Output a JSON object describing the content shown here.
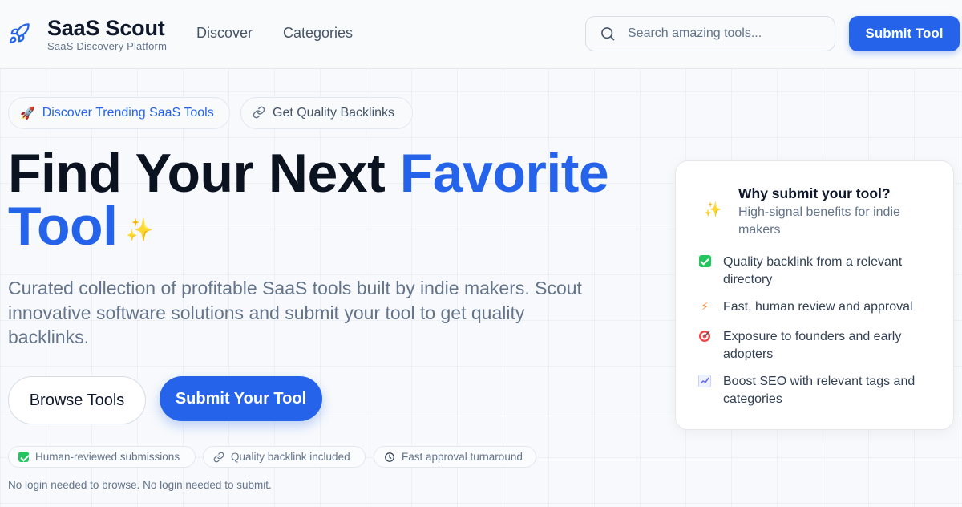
{
  "header": {
    "brand_name": "SaaS Scout",
    "brand_tagline": "SaaS Discovery Platform",
    "nav": [
      "Discover",
      "Categories"
    ],
    "search_placeholder": "Search amazing tools...",
    "submit_label": "Submit Tool"
  },
  "pills": [
    {
      "icon": "rocket-icon",
      "label": "Discover Trending SaaS Tools",
      "color": "#2563eb"
    },
    {
      "icon": "link-icon",
      "label": "Get Quality Backlinks",
      "color": "#475569"
    }
  ],
  "hero": {
    "title_main": "Find Your Next",
    "title_accent_1": "Favorite",
    "title_accent_2": "Tool",
    "description": "Curated collection of profitable SaaS tools built by indie makers. Scout innovative software solutions and submit your tool to get quality backlinks.",
    "browse_label": "Browse Tools",
    "submit_label": "Submit Your Tool"
  },
  "chips": [
    {
      "icon": "check-icon",
      "label": "Human-reviewed submissions"
    },
    {
      "icon": "link-icon",
      "label": "Quality backlink included"
    },
    {
      "icon": "clock-icon",
      "label": "Fast approval turnaround"
    }
  ],
  "note": "No login needed to browse. No login needed to submit.",
  "card": {
    "title": "Why submit your tool?",
    "subtitle": "High-signal benefits for indie makers",
    "benefits": [
      {
        "icon": "check-icon",
        "text": "Quality backlink from a relevant directory"
      },
      {
        "icon": "lightning-icon",
        "text": "Fast, human review and approval"
      },
      {
        "icon": "target-icon",
        "text": "Exposure to founders and early adopters"
      },
      {
        "icon": "chart-icon",
        "text": "Boost SEO with relevant tags and categories"
      }
    ]
  },
  "colors": {
    "accent": "#2563eb",
    "text": "#0f172a",
    "muted": "#64748b",
    "success": "#22c55e"
  }
}
